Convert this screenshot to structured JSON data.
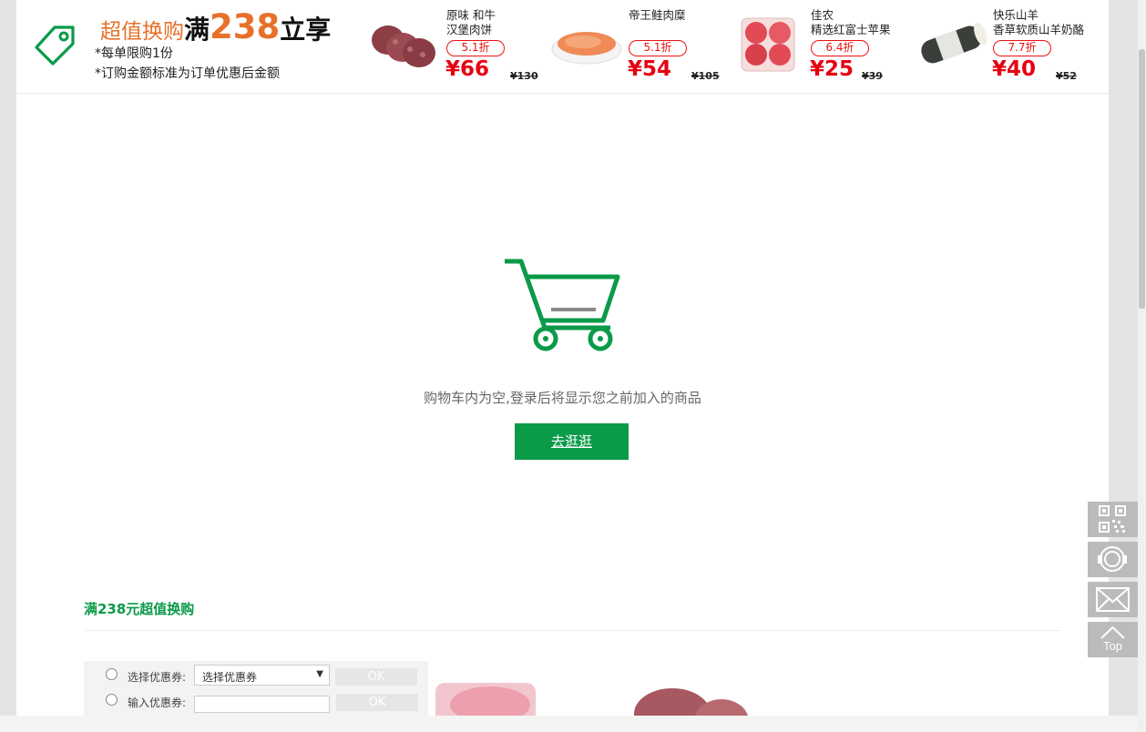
{
  "promo": {
    "title_a": "超值换购",
    "title_b": "满",
    "title_amount": "238",
    "title_c": "立享",
    "note_1": "*每单限购1份",
    "note_2": "*订购金额标准为订单优惠后金额"
  },
  "products": [
    {
      "name": "原味 和牛\n汉堡肉饼",
      "discount": "5.1折",
      "price": "¥66",
      "original": "¥130",
      "icon": "burger-patty-image"
    },
    {
      "name": "帝王鲑肉糜",
      "discount": "5.1折",
      "price": "¥54",
      "original": "¥105",
      "icon": "salmon-mince-image"
    },
    {
      "name": "佳农\n精选红富士苹果",
      "discount": "6.4折",
      "price": "¥25",
      "original": "¥39",
      "icon": "apple-box-image"
    },
    {
      "name": "快乐山羊\n香草软质山羊奶酪",
      "discount": "7.7折",
      "price": "¥40",
      "original": "¥52",
      "icon": "goat-cheese-image"
    }
  ],
  "cart": {
    "empty_message": "购物车内为空,登录后将显示您之前加入的商品",
    "go_button": "去逛逛"
  },
  "section": {
    "title": "满238元超值换购"
  },
  "coupon": {
    "select_label": "选择优惠券:",
    "select_value": "选择优惠券",
    "input_label": "输入优惠券:",
    "ok_label": "OK"
  },
  "side_tools": {
    "top_label": "Top"
  },
  "colors": {
    "brand_green": "#0a9a48",
    "promo_orange": "#e8702a",
    "price_red": "#e60012"
  }
}
